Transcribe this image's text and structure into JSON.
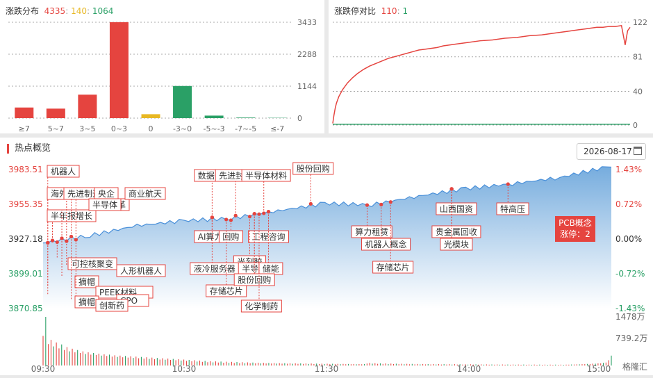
{
  "distribution": {
    "title": "涨跌分布",
    "up": "4335",
    "flat": "140",
    "down": "1064"
  },
  "ratio": {
    "title": "涨跌停对比",
    "limit_up": "110",
    "limit_down": "1"
  },
  "hot": {
    "title": "热点概览",
    "date": "2026-08-17",
    "pcb_label": "PCB概念",
    "pcb_sub": "涨停：2"
  },
  "watermark": "格隆汇",
  "colors": {
    "up": "#e5443f",
    "down": "#2aa066",
    "flat": "#e8b824",
    "area": "#7fb3e0"
  },
  "chart_data": [
    {
      "type": "bar",
      "categories": [
        "≥7",
        "5~7",
        "3~5",
        "0~3",
        "0",
        "-3~0",
        "-5~-3",
        "-7~-5",
        "≤-7"
      ],
      "values": [
        380,
        340,
        840,
        3433,
        140,
        1150,
        90,
        20,
        10
      ],
      "yticks": [
        0,
        1144,
        2288,
        3433
      ],
      "ylim": [
        0,
        3433
      ],
      "grid": true
    },
    {
      "type": "line",
      "yticks": [
        0,
        40,
        81,
        122
      ],
      "ylim": [
        0,
        122
      ],
      "grid": true,
      "series": [
        {
          "color": "#e5443f",
          "x": [
            0,
            1,
            2,
            3,
            5,
            8,
            12,
            16,
            20,
            25,
            30,
            35,
            40,
            45,
            50,
            55,
            60,
            65,
            70,
            75,
            80,
            85,
            90,
            95,
            100,
            110,
            120,
            130,
            140,
            150,
            160,
            170,
            180,
            190,
            200,
            205,
            210,
            215,
            220,
            225,
            230,
            235,
            238,
            240,
            242
          ],
          "values": [
            2,
            12,
            20,
            26,
            34,
            42,
            50,
            56,
            61,
            66,
            70,
            73,
            76,
            79,
            81,
            83,
            85,
            87,
            89,
            90,
            91,
            92,
            94,
            95,
            96,
            98,
            100,
            101,
            103,
            104,
            106,
            107,
            109,
            111,
            113,
            114,
            115,
            116,
            116,
            117,
            117,
            118,
            95,
            112,
            116
          ]
        },
        {
          "color": "#2aa066",
          "x": [
            0,
            60,
            120,
            180,
            242
          ],
          "values": [
            1,
            1,
            1,
            1,
            1
          ]
        }
      ]
    },
    {
      "type": "area",
      "x": [
        0,
        20,
        40,
        60,
        80,
        100,
        120,
        140,
        160,
        180,
        200,
        220,
        240
      ],
      "values": [
        3924.0,
        3930.0,
        3938.0,
        3942.0,
        3944.0,
        3950.0,
        3956.0,
        3955.0,
        3962.0,
        3968.0,
        3972.0,
        3977.0,
        3985.5
      ],
      "xticks": [
        "09:30",
        "10:30",
        "11:30",
        "14:00",
        "15:00"
      ],
      "y_left_ticks": [
        "3983.51",
        "3955.35",
        "3927.18",
        "3899.01",
        "3870.85"
      ],
      "y_right_ticks": [
        "1.43%",
        "0.72%",
        "0.00%",
        "-0.72%",
        "-1.43%"
      ],
      "ylim": [
        3870.85,
        3983.51
      ],
      "volume_ticks": [
        "1478万",
        "739.2万"
      ],
      "volume": [
        900,
        1478,
        650,
        780,
        580,
        700,
        520,
        640,
        470,
        560,
        430,
        510,
        400,
        470,
        380,
        430,
        350,
        400,
        330,
        380,
        320,
        360,
        300,
        340,
        290,
        330,
        270,
        310,
        260,
        300,
        250,
        290,
        240,
        280,
        230,
        270,
        220,
        260,
        210,
        250,
        200,
        240,
        190,
        230,
        180,
        220,
        175,
        210,
        170,
        200,
        160,
        190,
        150,
        180,
        140,
        170,
        130,
        160,
        120,
        150,
        110,
        140,
        100,
        130,
        95,
        125,
        90,
        120,
        85,
        115,
        80,
        110,
        75,
        105,
        70,
        100,
        70,
        95,
        68,
        90,
        66,
        85,
        64,
        80,
        62,
        78,
        60,
        75,
        58,
        72,
        56,
        70,
        54,
        68,
        52,
        66,
        50,
        64,
        48,
        62,
        46,
        60,
        44,
        58,
        42,
        56,
        40,
        54,
        40,
        52,
        40,
        50,
        38,
        48,
        38,
        46,
        38,
        45,
        36,
        44,
        36,
        43,
        60,
        80,
        55,
        70,
        50,
        65,
        48,
        62,
        45,
        58,
        42,
        55,
        40,
        52,
        38,
        50,
        36,
        48,
        35,
        46,
        34,
        45,
        33,
        44,
        32,
        43,
        31,
        42,
        30,
        41,
        30,
        40,
        29,
        39,
        28,
        38,
        28,
        37,
        27,
        36,
        27,
        35,
        26,
        34,
        26,
        33,
        25,
        32,
        25,
        32,
        24,
        31,
        24,
        30,
        23,
        30,
        23,
        29,
        22,
        29,
        22,
        28,
        22,
        28,
        21,
        27,
        21,
        27,
        20,
        26,
        20,
        26,
        20,
        26,
        20,
        26,
        25,
        30,
        30,
        35,
        35,
        40,
        40,
        48,
        45,
        55,
        55,
        65,
        65,
        80,
        90,
        160,
        300
      ],
      "annotations": [
        {
          "t": 2,
          "label": "机器人",
          "row": 0
        },
        {
          "t": 2,
          "label": "海外业务",
          "row": 1
        },
        {
          "t": 5,
          "label": "国企改革",
          "row": 2
        },
        {
          "t": 4,
          "label": "半年报增长",
          "row": 3
        },
        {
          "t": 10,
          "label": "先进制造",
          "row": 1
        },
        {
          "t": 12,
          "label": "央企",
          "row": 1
        },
        {
          "t": 14,
          "label": "商业航天",
          "row": 1
        },
        {
          "t": 8,
          "label": "半导体",
          "row": 2
        },
        {
          "t": 6,
          "label": "可控核聚变",
          "row": 4
        },
        {
          "t": 11,
          "label": "人形机器人",
          "row": 5
        },
        {
          "t": 9,
          "label": "摘帽",
          "row": 6
        },
        {
          "t": 3,
          "label": "PEEK材料",
          "row": 7
        },
        {
          "t": 3,
          "label": "CPO",
          "row": 8
        },
        {
          "t": 14,
          "label": "摘帽",
          "row": 9
        },
        {
          "t": 12,
          "label": "创新药",
          "row": 10
        },
        {
          "t": 73,
          "label": "数据中心",
          "row": 0
        },
        {
          "t": 82,
          "label": "先进封装",
          "row": 0
        },
        {
          "t": 95,
          "label": "半导体材料",
          "row": 0
        },
        {
          "t": 115,
          "label": "股份回购",
          "row": -1
        },
        {
          "t": 73,
          "label": "AI算力",
          "row": 2
        },
        {
          "t": 80,
          "label": "回购",
          "row": 2
        },
        {
          "t": 96,
          "label": "工程咨询",
          "row": 2
        },
        {
          "t": 88,
          "label": "光刻胶",
          "row": 3
        },
        {
          "t": 73,
          "label": "液冷服务器",
          "row": 4
        },
        {
          "t": 90,
          "label": "半导体",
          "row": 4
        },
        {
          "t": 97,
          "label": "储能",
          "row": 4
        },
        {
          "t": 78,
          "label": "存储芯片",
          "row": 6
        },
        {
          "t": 90,
          "label": "股份回购",
          "row": 5
        },
        {
          "t": 93,
          "label": "化学制药",
          "row": 7
        },
        {
          "t": 140,
          "label": "算力租赁",
          "row": 2
        },
        {
          "t": 146,
          "label": "机器人概念",
          "row": 3
        },
        {
          "t": 149,
          "label": "存储芯片",
          "row": 4
        },
        {
          "t": 176,
          "label": "山西国资",
          "row": 1
        },
        {
          "t": 176,
          "label": "贵金属回收",
          "row": 2
        },
        {
          "t": 176,
          "label": "光模块",
          "row": 3
        },
        {
          "t": 200,
          "label": "特高压",
          "row": 1
        }
      ]
    }
  ]
}
